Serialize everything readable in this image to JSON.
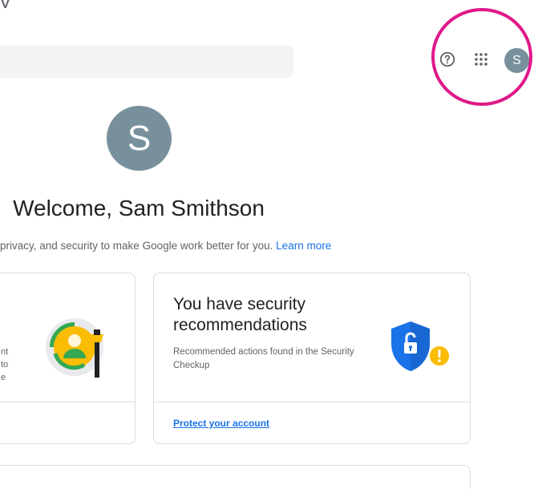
{
  "header": {
    "top_fragment": "y",
    "avatar_initial": "S",
    "icons": [
      "help-icon",
      "apps-grid-icon"
    ]
  },
  "profile": {
    "avatar_initial": "S",
    "welcome": "Welcome, Sam Smithson",
    "subtitle": "privacy, and security to make Google work better for you.",
    "learn_more": "Learn more"
  },
  "cards": {
    "left": {
      "text_lines": [
        "nt",
        "to",
        "e"
      ],
      "icon": "personal-info-illustration"
    },
    "security": {
      "title": "You have security recommendations",
      "description": "Recommended actions found in the Security Checkup",
      "link": "Protect your account",
      "icon": "security-shield-illustration"
    }
  },
  "colors": {
    "accent": "#1a73e8",
    "avatar": "#78909c",
    "highlight": "#e0188a",
    "shield": "#1a73e8",
    "warning": "#fbbc04"
  }
}
